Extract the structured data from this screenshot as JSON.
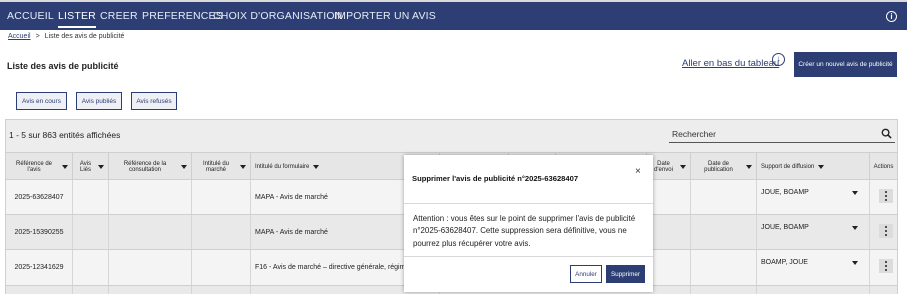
{
  "nav": {
    "items": [
      "ACCUEIL",
      "LISTER",
      "CREER",
      "PREFERENCES",
      "CHOIX D'ORGANISATION",
      "IMPORTER UN AVIS"
    ],
    "active": "LISTER",
    "info_icon": "info-circle-icon"
  },
  "breadcrumb": {
    "home": "Accueil",
    "sep": ">",
    "current": "Liste des avis de publicité"
  },
  "page": {
    "title": "Liste des avis de publicité",
    "scroll_link": "Aller en bas du tableau",
    "create_button": "Créer un nouvel avis de publicité"
  },
  "filters": [
    "Avis en cours",
    "Avis publiés",
    "Avis refusés"
  ],
  "table": {
    "count": "1 - 5 sur 863 entités affichées",
    "search_placeholder": "Rechercher",
    "columns": [
      "Référence de l'avis",
      "Avis Liés",
      "Référence de la consultation",
      "Intitulé du marché",
      "Intitulé du formulaire",
      "",
      "",
      "",
      "Date d'envoi",
      "Date de publication",
      "Support de diffusion",
      "Actions"
    ],
    "rows": [
      {
        "ref": "2025-63628407",
        "formulaire": "MAPA - Avis de marché",
        "support": "JOUE, BOAMP"
      },
      {
        "ref": "2025-15390255",
        "formulaire": "MAPA - Avis de marché",
        "support": "JOUE, BOAMP"
      },
      {
        "ref": "2025-12341629",
        "formulaire": "F16 - Avis de marché – directive générale, régime ordinaire",
        "support": "BOAMP, JOUE"
      }
    ]
  },
  "modal": {
    "title": "Supprimer l'avis de publicité n°2025-63628407",
    "close": "×",
    "body": "Attention : vous êtes sur le point de supprimer l'avis de publicité n°2025-63628407. Cette suppression sera définitive, vous ne pourrez plus récupérer votre avis.",
    "cancel": "Annuler",
    "confirm": "Supprimer"
  },
  "colors": {
    "primary": "#2c3e73",
    "nav_bg": "#2c3e73",
    "table_bg": "#ededed"
  }
}
